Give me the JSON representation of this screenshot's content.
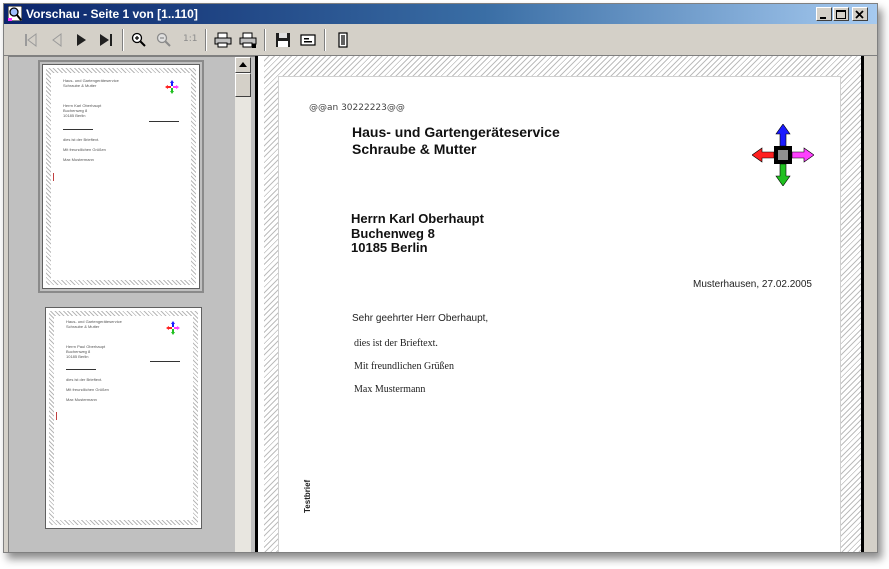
{
  "window": {
    "title": "Vorschau - Seite 1 von [1..110]",
    "title_color": "#0a246a"
  },
  "toolbar": {
    "buttons": [
      {
        "name": "first-page-button",
        "icon": "first-page-icon",
        "enabled": false
      },
      {
        "name": "previous-page-button",
        "icon": "previous-page-icon",
        "enabled": false
      },
      {
        "name": "next-page-button",
        "icon": "next-page-icon",
        "enabled": true
      },
      {
        "name": "last-page-button",
        "icon": "last-page-icon",
        "enabled": true
      },
      {
        "name": "zoom-in-button",
        "icon": "zoom-in-icon",
        "enabled": true
      },
      {
        "name": "zoom-out-button",
        "icon": "zoom-out-icon",
        "enabled": false
      },
      {
        "name": "actual-size-button",
        "icon": "actual-size-icon",
        "enabled": false
      },
      {
        "name": "print-button",
        "icon": "printer-icon",
        "enabled": true
      },
      {
        "name": "print-setup-button",
        "icon": "printer-setup-icon",
        "enabled": true
      },
      {
        "name": "save-button",
        "icon": "floppy-disk-icon",
        "enabled": true
      },
      {
        "name": "send-button",
        "icon": "envelope-icon",
        "enabled": true
      },
      {
        "name": "exit-button",
        "icon": "exit-door-icon",
        "enabled": true
      }
    ],
    "actual_size_label": "1:1"
  },
  "letter": {
    "mark_prefix": "@@",
    "mark_number": "an 30222223",
    "mark_suffix": "@@",
    "company_line1": "Haus- und Gartengeräteservice",
    "company_line2": "Schraube & Mutter",
    "recipient_name": "Herrn Karl Oberhaupt",
    "recipient_street": "Buchenweg 8",
    "recipient_city": "10185 Berlin",
    "date_line": "Musterhausen, 27.02.2005",
    "salutation": "Sehr geehrter Herr Oberhaupt,",
    "body": "dies ist der Brieftext.",
    "closing": "Mit freundlichen Grüßen",
    "signature": "Max Mustermann",
    "vertical_label": "Testbrief"
  },
  "logo_colors": {
    "up": "#1a1aff",
    "left": "#ff2020",
    "right": "#ff40ff",
    "down": "#20c020"
  }
}
